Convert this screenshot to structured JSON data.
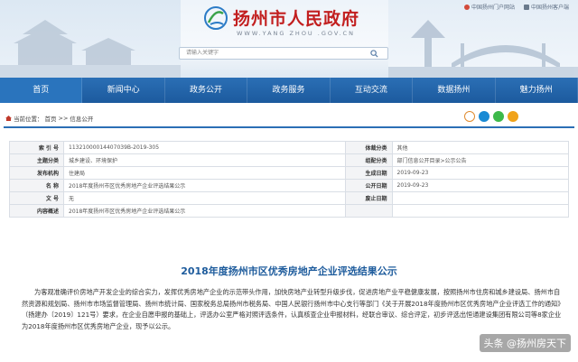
{
  "header": {
    "site_title": "扬州市人民政府",
    "site_url": "WWW.YANG ZHOU .GOV.CN",
    "search_placeholder": "请输入关键字",
    "top_links": [
      "中国扬州门户网站",
      "中国扬州客户端"
    ]
  },
  "nav": {
    "items": [
      "首页",
      "新闻中心",
      "政务公开",
      "政务服务",
      "互动交流",
      "数据扬州",
      "魅力扬州"
    ]
  },
  "breadcrumb": {
    "label": "当前位置：",
    "home": "首页",
    "sep1": ">>",
    "current": "信息公开"
  },
  "meta": {
    "rows": [
      {
        "k1": "索  引  号",
        "v1": "11321000014407039B-2019-305",
        "k2": "体裁分类",
        "v2": "其他"
      },
      {
        "k1": "主题分类",
        "v1": "城乡建设、环境保护",
        "k2": "组配分类",
        "v2": "部门信息公开目录>公示公告"
      },
      {
        "k1": "发布机构",
        "v1": "住建局",
        "k2": "生成日期",
        "v2": "2019-09-23"
      },
      {
        "k1": "名    称",
        "v1": "2018年度扬州市区优秀房地产企业评选结果公示",
        "k2": "公开日期",
        "v2": "2019-09-23"
      },
      {
        "k1": "文    号",
        "v1": "无",
        "k2": "废止日期",
        "v2": ""
      },
      {
        "k1": "内容概述",
        "v1": "2018年度扬州市区优秀房地产企业评选结果公示",
        "k2": "",
        "v2": ""
      }
    ]
  },
  "article": {
    "title": "2018年度扬州市区优秀房地产企业评选结果公示",
    "body": "为客观准确评价房地产开发企业的综合实力，发挥优秀房地产企业的示范带头作用，加快房地产业转型升级步伐，促进房地产业平稳健康发展，按照扬州市住房和城乡建设局、扬州市自然资源和规划局、扬州市市场监督管理局、扬州市统计局、国家税务总局扬州市税务局、中国人民银行扬州市中心支行等部门《关于开展2018年度扬州市区优秀房地产企业评选工作的通知》（扬建办〔2019〕121号）要求，在企业自愿申报的基础上，评选办公室严格对照评选条件，认真核查企业申报材料，经联合审议、综合评定，初步评选出恒通建设集团有限公司等8家企业为2018年度扬州市区优秀房地产企业，现予以公示。"
  },
  "watermark": {
    "text": "头条 @扬州房天下"
  }
}
